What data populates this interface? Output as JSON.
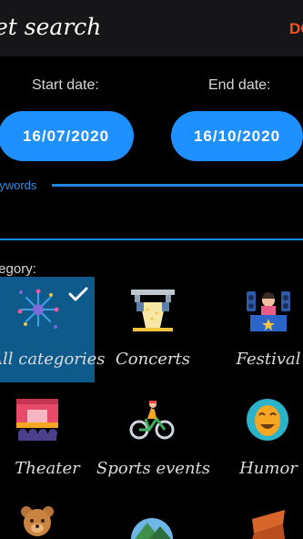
{
  "header": {
    "title": "et search",
    "done_label": "DO"
  },
  "dates": {
    "start_label": "Start date:",
    "start_value": "16/07/2020",
    "end_label": "End date:",
    "end_value": "16/10/2020"
  },
  "keywords": {
    "label": "eywords",
    "value": ""
  },
  "category": {
    "label": "tegory:"
  },
  "categories": [
    {
      "label": "All categories",
      "selected": true,
      "icon": "fireworks-icon"
    },
    {
      "label": "Concerts",
      "selected": false,
      "icon": "stage-lights-icon"
    },
    {
      "label": "Festival",
      "selected": false,
      "icon": "dj-booth-icon"
    },
    {
      "label": "Theater",
      "selected": false,
      "icon": "theater-curtain-icon"
    },
    {
      "label": "Sports events",
      "selected": false,
      "icon": "cyclist-icon"
    },
    {
      "label": "Humor",
      "selected": false,
      "icon": "comedy-mask-icon"
    },
    {
      "label": "",
      "selected": false,
      "icon": "teddy-bear-icon"
    },
    {
      "label": "",
      "selected": false,
      "icon": "landscape-icon"
    },
    {
      "label": "",
      "selected": false,
      "icon": "food-icon"
    }
  ],
  "colors": {
    "accent": "#1e90ff",
    "done": "#f4511e",
    "selected_tile": "#0e5a8a",
    "topbar": "#161618"
  }
}
